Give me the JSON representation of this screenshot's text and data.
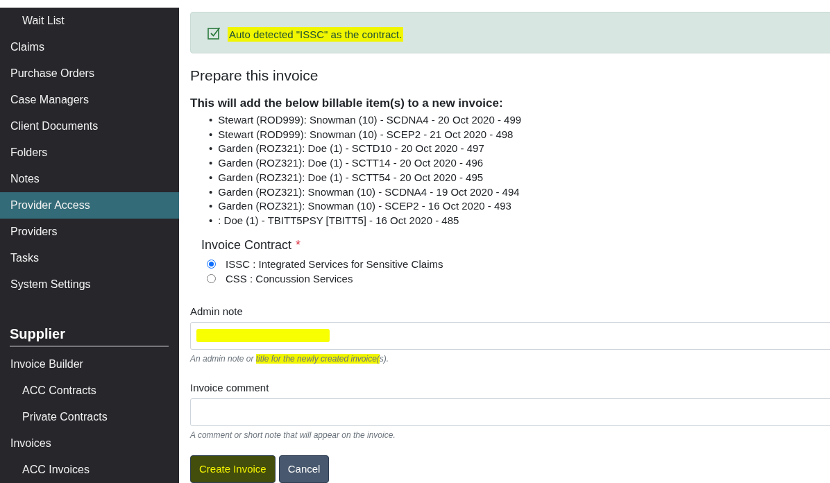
{
  "sidebar": {
    "continued_children": [
      {
        "label": "Wait List",
        "selected": false
      }
    ],
    "items": [
      {
        "label": "Claims",
        "selected": false
      },
      {
        "label": "Purchase Orders",
        "selected": false
      },
      {
        "label": "Case Managers",
        "selected": false
      },
      {
        "label": "Client Documents",
        "selected": false
      },
      {
        "label": "Folders",
        "selected": false
      },
      {
        "label": "Notes",
        "selected": false
      },
      {
        "label": "Provider Access",
        "selected": true
      },
      {
        "label": "Providers",
        "selected": false
      },
      {
        "label": "Tasks",
        "selected": false
      },
      {
        "label": "System Settings",
        "selected": false
      }
    ],
    "sections": [
      {
        "title": "Supplier",
        "items": [
          {
            "label": "Invoice Builder",
            "selected": false,
            "children": [
              {
                "label": "ACC Contracts",
                "selected": false
              },
              {
                "label": "Private Contracts",
                "selected": false
              }
            ]
          },
          {
            "label": "Invoices",
            "selected": false,
            "children": [
              {
                "label": "ACC Invoices",
                "selected": false
              }
            ]
          }
        ]
      }
    ]
  },
  "alert": {
    "text": "Auto detected \"ISSC\" as the contract.",
    "highlighted": true
  },
  "title": "Prepare this invoice",
  "subtitle": "This will add the below billable item(s) to a new invoice:",
  "items": [
    {
      "marker": "•",
      "text": "Stewart (ROD999): Snowman (10) - SCDNA4 - 20 Oct 2020 - 499"
    },
    {
      "marker": "•",
      "text": "Stewart (ROD999): Snowman (10) - SCEP2 - 21 Oct 2020 - 498"
    },
    {
      "marker": "•",
      "text": "Garden (ROZ321): Doe (1) - SCTD10 - 20 Oct 2020 - 497"
    },
    {
      "marker": "•",
      "text": "Garden (ROZ321): Doe (1) - SCTT14 - 20 Oct 2020 - 496"
    },
    {
      "marker": "•",
      "text": "Garden (ROZ321): Doe (1) - SCTT54 - 20 Oct 2020 - 495"
    },
    {
      "marker": "•",
      "text": "Garden (ROZ321): Snowman (10) - SCDNA4 - 19 Oct 2020 - 494"
    },
    {
      "marker": "•",
      "text": "Garden (ROZ321): Snowman (10) - SCEP2 - 16 Oct 2020 - 493"
    },
    {
      "marker": "•",
      "text": ": Doe (1) - TBITT5PSY [TBITT5] - 16 Oct 2020 - 485"
    }
  ],
  "contract": {
    "label": "Invoice Contract",
    "required_mark": "*",
    "options": [
      {
        "label": "ISSC : Integrated Services for Sensitive Claims",
        "selected": true
      },
      {
        "label": "CSS : Concussion Services",
        "selected": false
      }
    ]
  },
  "fields": [
    {
      "label": "Admin note",
      "redacted": true,
      "hint": [
        {
          "text": "An admin note or ",
          "highlighted": false
        },
        {
          "text": "title for the newly created invoice(",
          "highlighted": true
        },
        {
          "text": "s).",
          "highlighted": false
        }
      ]
    },
    {
      "label": "Invoice comment",
      "redacted": false,
      "hint": [
        {
          "text": "A comment or short note that will appear on the invoice.",
          "highlighted": false
        }
      ]
    }
  ],
  "buttons": [
    {
      "label": "Create Invoice",
      "highlighted": true
    },
    {
      "label": "Cancel",
      "highlighted": false
    }
  ]
}
